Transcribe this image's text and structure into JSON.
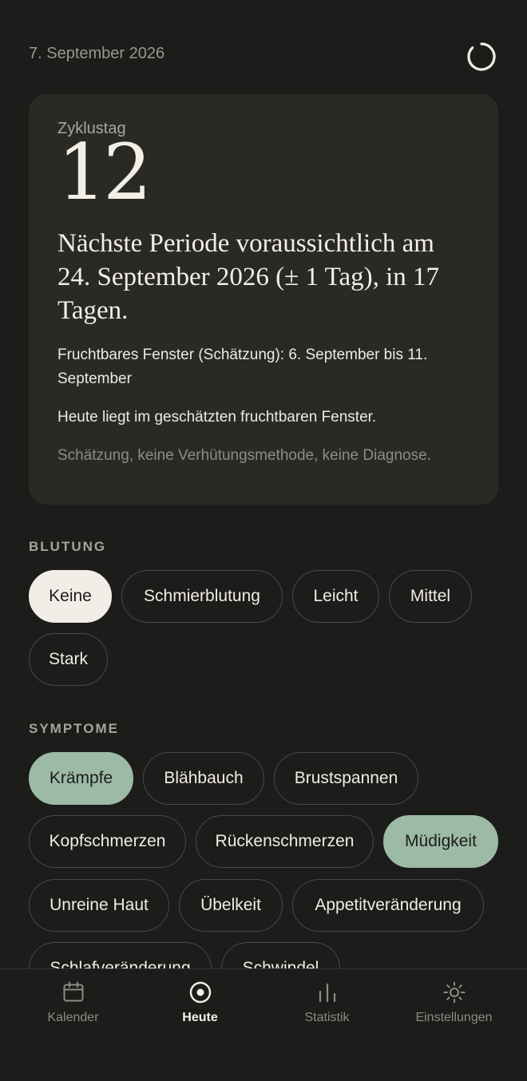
{
  "header": {
    "date": "7. September 2026",
    "sync_icon": "sync-icon"
  },
  "cycle_card": {
    "label": "Zyklustag",
    "day": "12",
    "prediction": "Nächste Periode voraussichtlich am 24. September 2026 (± 1 Tag), in 17 Tagen.",
    "fertile_window": "Fruchtbares Fenster (Schätzung): 6. September bis 11. September",
    "today_note": "Heute liegt im geschätzten fruchtbaren Fenster.",
    "disclaimer": "Schätzung, keine Verhütungsmethode, keine Diagnose."
  },
  "bleeding": {
    "title": "BLUTUNG",
    "options": [
      "Keine",
      "Schmierblutung",
      "Leicht",
      "Mittel",
      "Stark"
    ],
    "selected": "Keine"
  },
  "symptoms": {
    "title": "SYMPTOME",
    "options": [
      "Krämpfe",
      "Blähbauch",
      "Brustspannen",
      "Kopfschmerzen",
      "Rückenschmerzen",
      "Müdigkeit",
      "Unreine Haut",
      "Übelkeit",
      "Appetitveränderung",
      "Schlafveränderung",
      "Schwindel"
    ],
    "selected": [
      "Krämpfe",
      "Müdigkeit"
    ]
  },
  "colors": {
    "background": "#1c1c1a",
    "card": "#2a2a25",
    "selected_light": "#f2ede6",
    "selected_green": "#9cbaa6"
  },
  "nav": {
    "items": [
      {
        "label": "Kalender",
        "icon": "calendar-icon"
      },
      {
        "label": "Heute",
        "icon": "today-icon"
      },
      {
        "label": "Statistik",
        "icon": "statistics-icon"
      },
      {
        "label": "Einstellungen",
        "icon": "settings-icon"
      }
    ],
    "active": "Heute"
  }
}
